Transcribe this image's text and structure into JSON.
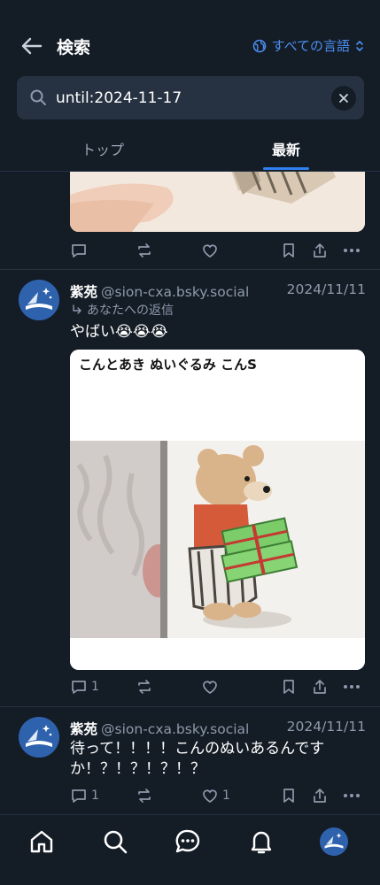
{
  "header": {
    "title": "検索",
    "language_label": "すべての言語"
  },
  "search": {
    "value": "until:2024-11-17"
  },
  "tabs": [
    {
      "label": "トップ",
      "active": false
    },
    {
      "label": "最新",
      "active": true
    }
  ],
  "posts": [
    {
      "display_name": "紫苑",
      "handle": "@sion-cxa.bsky.social",
      "date": "2024/11/11",
      "reply_hint": "あなたへの返信",
      "text": "やばい😭😭😭",
      "image_caption": "こんとあき ぬいぐるみ こんS",
      "reply_count": "1",
      "like_count": ""
    },
    {
      "display_name": "紫苑",
      "handle": "@sion-cxa.bsky.social",
      "date": "2024/11/11",
      "text": "待って！！！！こんのぬいあるんですか！？！？！？！？",
      "reply_count": "1",
      "like_count": "1"
    }
  ],
  "colors": {
    "background": "#141c26",
    "accent": "#2f7ff0",
    "muted": "#8d9aab"
  },
  "nav": {
    "icons": [
      "home-icon",
      "search-icon",
      "chat-icon",
      "bell-icon",
      "profile-avatar"
    ]
  }
}
